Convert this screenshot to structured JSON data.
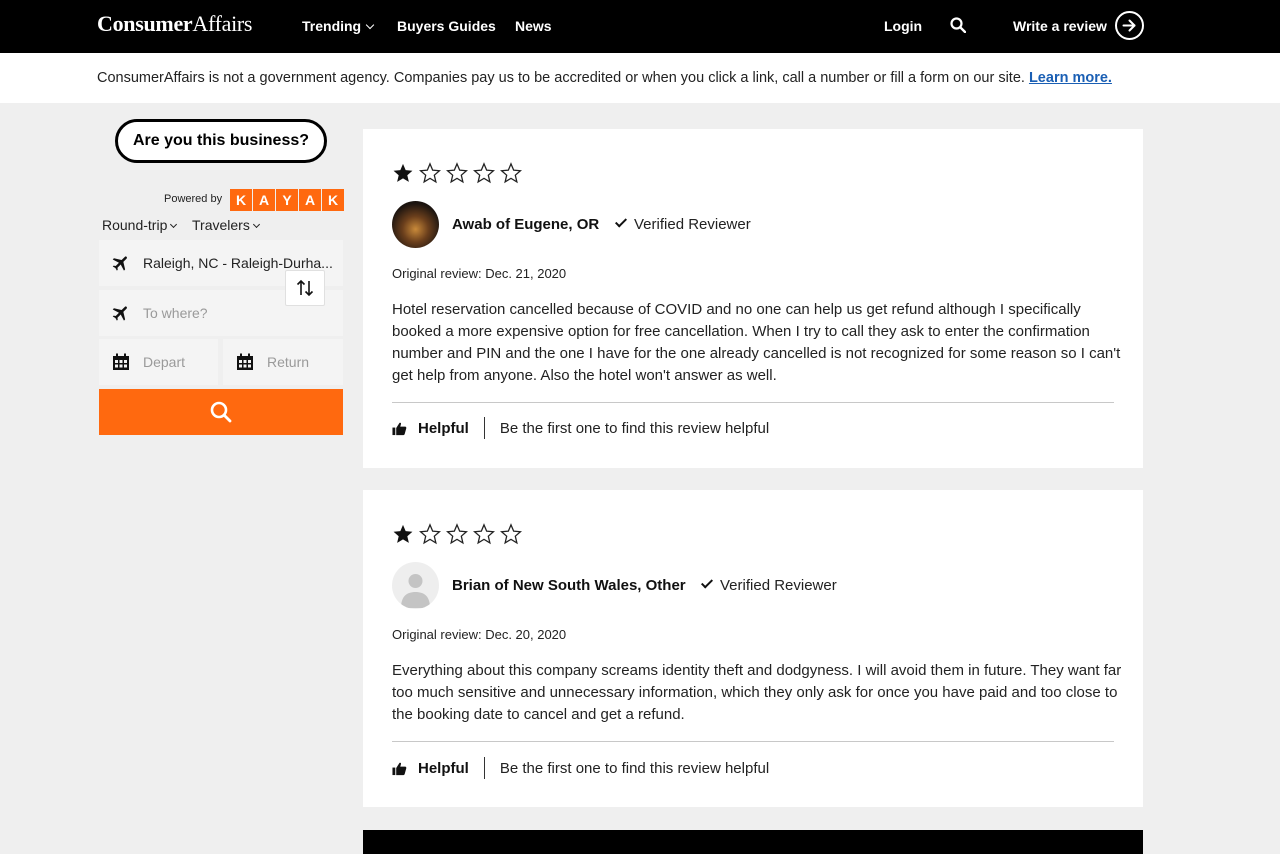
{
  "header": {
    "logo_bold": "Consumer",
    "logo_regular": "Affairs",
    "nav": {
      "trending": "Trending",
      "buyers_guides": "Buyers Guides",
      "news": "News"
    },
    "login": "Login",
    "write_review": "Write a review"
  },
  "disclaimer": {
    "text": "ConsumerAffairs is not a government agency. Companies pay us to be accredited or when you click a link, call a number or fill a form on our site.",
    "link": "Learn more."
  },
  "sidebar": {
    "business_button": "Are you this business?",
    "powered_by": "Powered by",
    "kayak_letters": [
      "K",
      "A",
      "Y",
      "A",
      "K"
    ],
    "trip_type": "Round-trip",
    "travelers": "Travelers",
    "from_value": "Raleigh, NC - Raleigh-Durha...",
    "to_placeholder": "To where?",
    "depart_placeholder": "Depart",
    "return_placeholder": "Return"
  },
  "reviews": [
    {
      "rating": 1,
      "reviewer": "Awab of Eugene, OR",
      "verified": "Verified Reviewer",
      "date": "Original review: Dec. 21, 2020",
      "body": "Hotel reservation cancelled because of COVID and no one can help us get refund although I specifically booked a more expensive option for free cancellation. When I try to call they ask to enter the confirmation number and PIN and the one I have for the one already cancelled is not recognized for some reason so I can't get help from anyone. Also the hotel won't answer as well.",
      "helpful": "Helpful",
      "helpful_note": "Be the first one to find this review helpful"
    },
    {
      "rating": 1,
      "reviewer": "Brian of New South Wales, Other",
      "verified": "Verified Reviewer",
      "date": "Original review: Dec. 20, 2020",
      "body": "Everything about this company screams identity theft and dodgyness. I will avoid them in future. They want far too much sensitive and unnecessary information, which they only ask for once you have paid and too close to the booking date to cancel and get a refund.",
      "helpful": "Helpful",
      "helpful_note": "Be the first one to find this review helpful"
    }
  ],
  "colors": {
    "kayak_orange": "#ff690f",
    "link_blue": "#1a5fb4",
    "header_bg": "#000000"
  }
}
